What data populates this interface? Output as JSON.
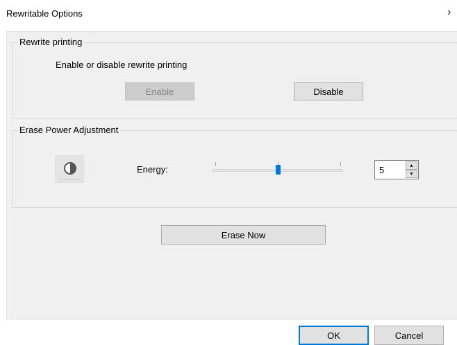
{
  "window": {
    "title": "Rewritable Options"
  },
  "rewrite_printing": {
    "group_label": "Rewrite printing",
    "description": "Enable or disable rewrite printing",
    "enable_label": "Enable",
    "enable_disabled": true,
    "disable_label": "Disable"
  },
  "erase_power": {
    "group_label": "Erase Power Adjustment",
    "icon": "contrast-icon",
    "energy_label": "Energy:",
    "slider_min": 1,
    "slider_max": 9,
    "slider_value": 5,
    "energy_value": "5"
  },
  "actions": {
    "erase_now_label": "Erase Now",
    "ok_label": "OK",
    "cancel_label": "Cancel"
  },
  "colors": {
    "accent": "#0078d7",
    "dialog_bg": "#f0f0f0",
    "button_bg": "#e1e1e1"
  }
}
